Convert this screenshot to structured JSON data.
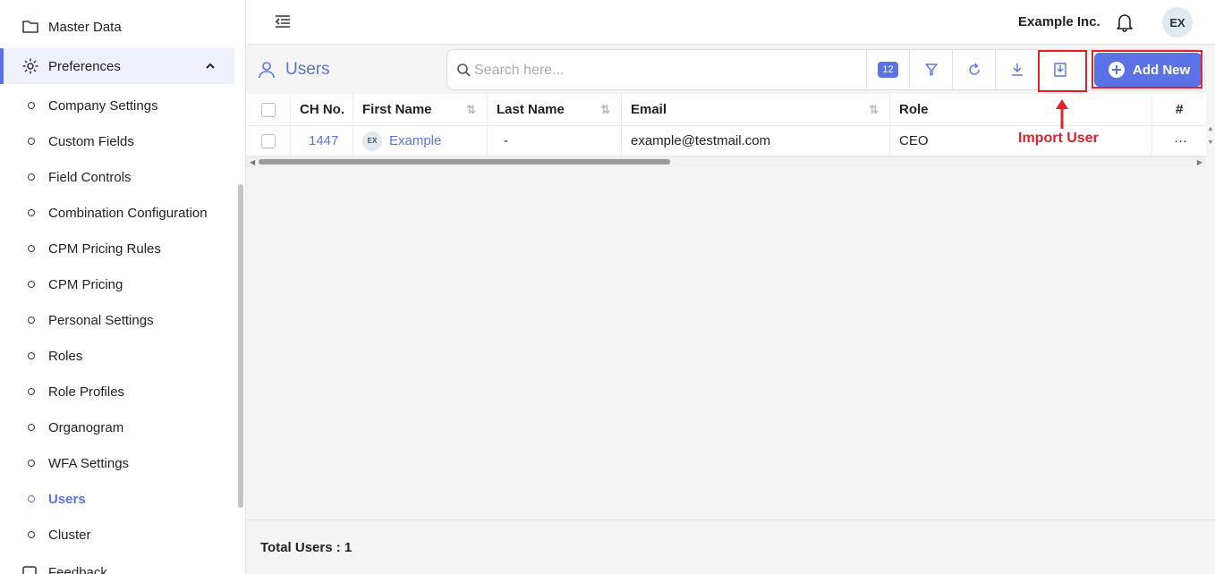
{
  "sidebar": {
    "master_data": "Master Data",
    "preferences": "Preferences",
    "items": [
      {
        "label": "Company Settings"
      },
      {
        "label": "Custom Fields"
      },
      {
        "label": "Field Controls"
      },
      {
        "label": "Combination Configuration"
      },
      {
        "label": "CPM Pricing Rules"
      },
      {
        "label": "CPM Pricing"
      },
      {
        "label": "Personal Settings"
      },
      {
        "label": "Roles"
      },
      {
        "label": "Role Profiles"
      },
      {
        "label": "Organogram"
      },
      {
        "label": "WFA Settings"
      },
      {
        "label": "Users"
      },
      {
        "label": "Cluster"
      }
    ],
    "feedback": "Feedback"
  },
  "header": {
    "company": "Example Inc.",
    "avatar_initials": "EX"
  },
  "page": {
    "title": "Users",
    "search_placeholder": "Search here...",
    "column_count_badge": "12",
    "add_new_label": "Add New",
    "annotation_label": "Import User",
    "total_label": "Total Users : 1"
  },
  "table": {
    "columns": [
      "CH No.",
      "First Name",
      "Last Name",
      "Email",
      "Role",
      "#"
    ],
    "rows": [
      {
        "ch_no": "1447",
        "avatar": "EX",
        "first_name": "Example",
        "last_name": "-",
        "email": "example@testmail.com",
        "role": "CEO",
        "actions": "···"
      }
    ]
  },
  "colors": {
    "accent": "#5b72e6",
    "annotation": "#e0202a"
  }
}
